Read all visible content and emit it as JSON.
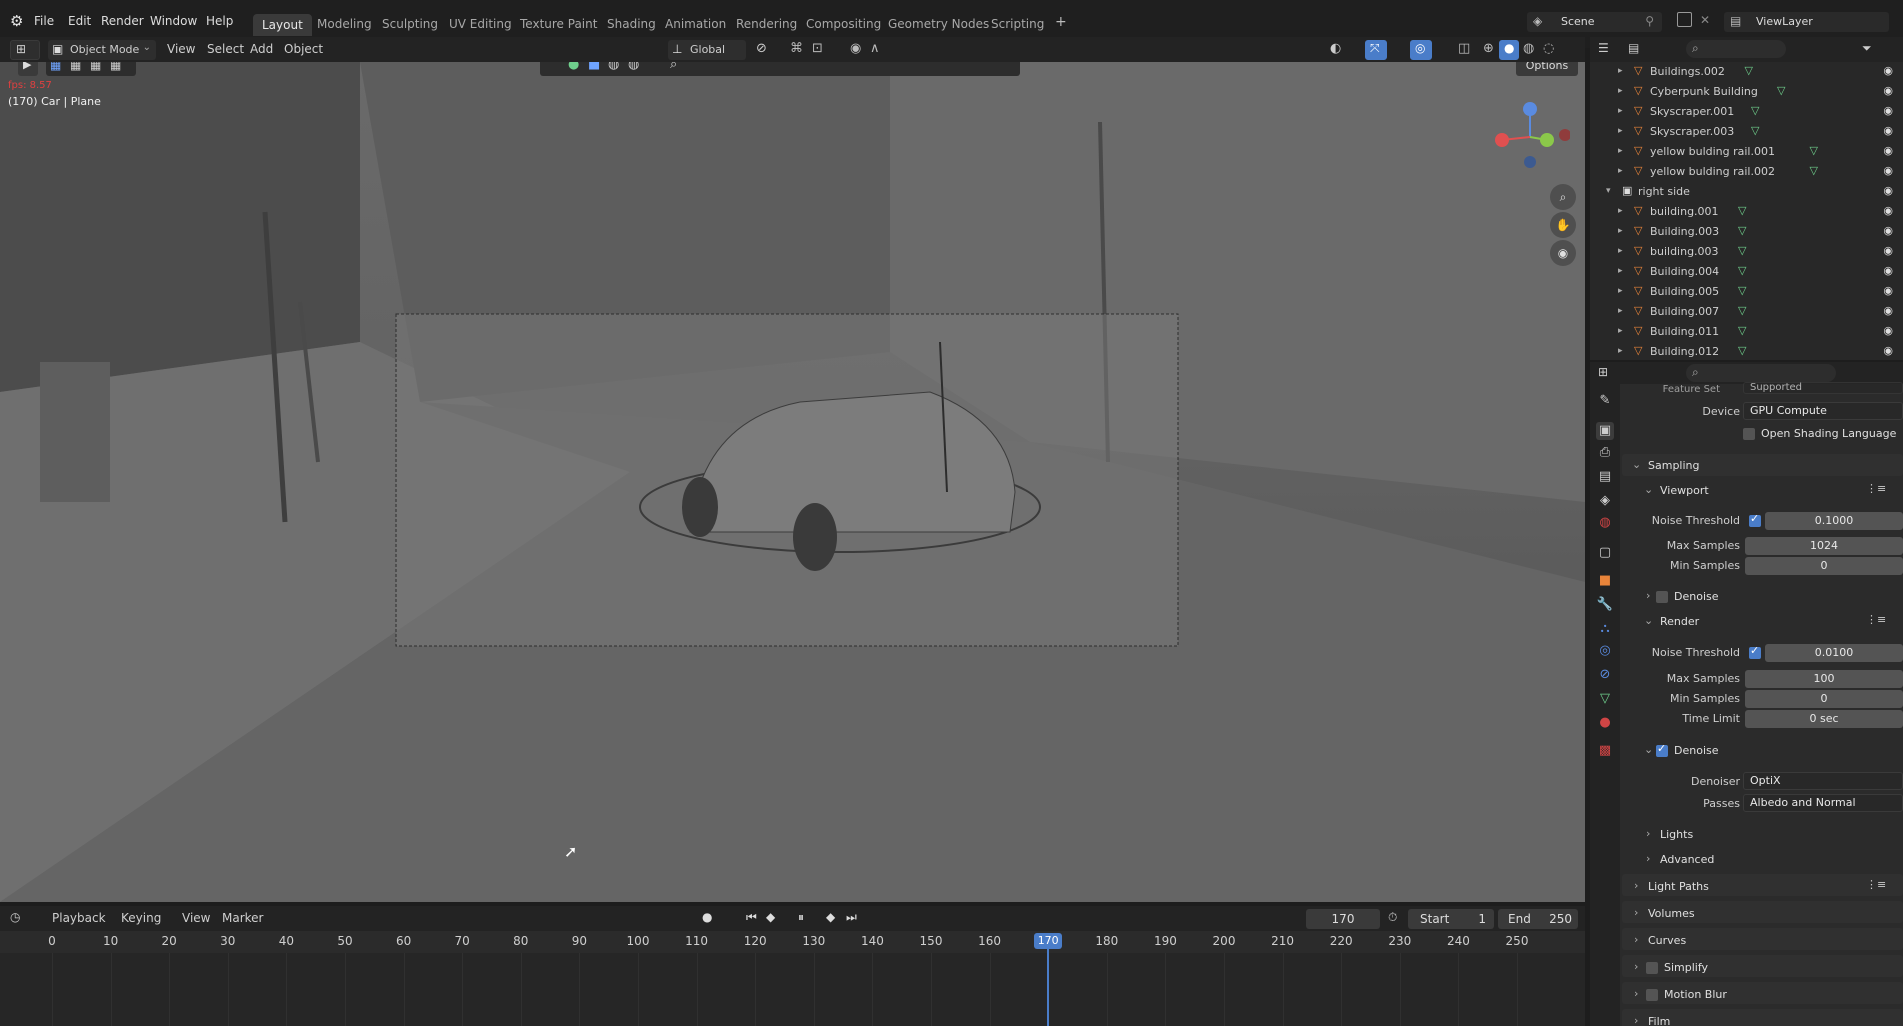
{
  "app": {
    "title": "Blender"
  },
  "menu": [
    "File",
    "Edit",
    "Render",
    "Window",
    "Help"
  ],
  "workspaces": [
    {
      "label": "Layout",
      "active": true
    },
    {
      "label": "Modeling"
    },
    {
      "label": "Sculpting"
    },
    {
      "label": "UV Editing"
    },
    {
      "label": "Texture Paint"
    },
    {
      "label": "Shading"
    },
    {
      "label": "Animation"
    },
    {
      "label": "Rendering"
    },
    {
      "label": "Compositing"
    },
    {
      "label": "Geometry Nodes"
    },
    {
      "label": "Scripting"
    }
  ],
  "topright": {
    "scene": "Scene",
    "viewlayer": "ViewLayer"
  },
  "viewport_header": {
    "mode": "Object Mode",
    "menus": [
      "View",
      "Select",
      "Add",
      "Object"
    ],
    "transform": "Global",
    "options": "Options"
  },
  "viewport": {
    "fps_text": "fps: 8.57",
    "object_info": "(170) Car | Plane"
  },
  "outliner": {
    "rows": [
      {
        "label": "Buildings.002",
        "indent": 1
      },
      {
        "label": "Cyberpunk Building",
        "indent": 1
      },
      {
        "label": "Skyscraper.001",
        "indent": 1
      },
      {
        "label": "Skyscraper.003",
        "indent": 1
      },
      {
        "label": "yellow bulding rail.001",
        "indent": 1
      },
      {
        "label": "yellow bulding rail.002",
        "indent": 1
      },
      {
        "label": "right side",
        "indent": 0,
        "collection": true
      },
      {
        "label": "building.001",
        "indent": 1
      },
      {
        "label": "Building.003",
        "indent": 1
      },
      {
        "label": "building.003",
        "indent": 1
      },
      {
        "label": "Building.004",
        "indent": 1
      },
      {
        "label": "Building.005",
        "indent": 1
      },
      {
        "label": "Building.007",
        "indent": 1
      },
      {
        "label": "Building.011",
        "indent": 1
      },
      {
        "label": "Building.012",
        "indent": 1
      }
    ]
  },
  "properties": {
    "feature_set_label": "Feature Set",
    "feature_set_value": "Supported",
    "device_label": "Device",
    "device_value": "GPU Compute",
    "osl_label": "Open Shading Language",
    "sampling": "Sampling",
    "viewport_section": "Viewport",
    "noise_threshold_label": "Noise Threshold",
    "vp_noise_threshold": "0.1000",
    "max_samples_label": "Max Samples",
    "vp_max_samples": "1024",
    "min_samples_label": "Min Samples",
    "vp_min_samples": "0",
    "denoise_label": "Denoise",
    "render_section": "Render",
    "r_noise_threshold": "0.0100",
    "r_max_samples": "100",
    "r_min_samples": "0",
    "time_limit_label": "Time Limit",
    "r_time_limit": "0 sec",
    "denoiser_label": "Denoiser",
    "denoiser_value": "OptiX",
    "passes_label": "Passes",
    "passes_value": "Albedo and Normal",
    "lights": "Lights",
    "advanced": "Advanced",
    "light_paths": "Light Paths",
    "volumes": "Volumes",
    "curves": "Curves",
    "simplify": "Simplify",
    "motion_blur": "Motion Blur",
    "film": "Film"
  },
  "timeline": {
    "menus": [
      "Playback",
      "Keying",
      "View",
      "Marker"
    ],
    "current_frame": "170",
    "start_label": "Start",
    "start": "1",
    "end_label": "End",
    "end": "250",
    "ticks": [
      "0",
      "10",
      "20",
      "30",
      "40",
      "50",
      "60",
      "70",
      "80",
      "90",
      "100",
      "110",
      "120",
      "130",
      "140",
      "150",
      "160",
      "170",
      "180",
      "190",
      "200",
      "210",
      "220",
      "230",
      "240",
      "250"
    ]
  },
  "colors": {
    "accent": "#4a7dc9",
    "object_orange": "#e8843a",
    "mesh_green": "#6fcf8c"
  }
}
